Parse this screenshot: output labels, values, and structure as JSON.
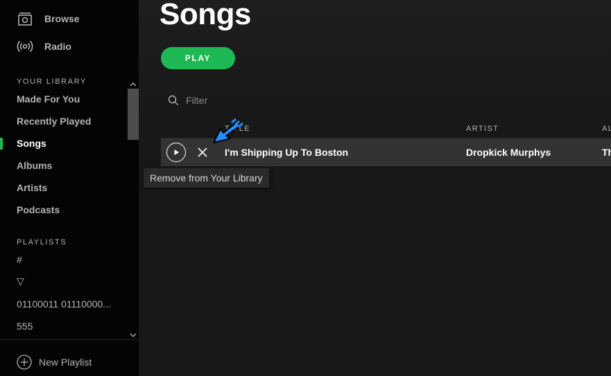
{
  "sidebar": {
    "nav": [
      {
        "label": "Browse",
        "icon": "browse-icon"
      },
      {
        "label": "Radio",
        "icon": "radio-icon"
      }
    ],
    "library_heading": "YOUR LIBRARY",
    "library_items": [
      {
        "label": "Made For You",
        "active": false
      },
      {
        "label": "Recently Played",
        "active": false
      },
      {
        "label": "Songs",
        "active": true
      },
      {
        "label": "Albums",
        "active": false
      },
      {
        "label": "Artists",
        "active": false
      },
      {
        "label": "Podcasts",
        "active": false
      }
    ],
    "playlists_heading": "PLAYLISTS",
    "playlists": [
      {
        "label": "#"
      },
      {
        "label": "▽"
      },
      {
        "label": "01100011 01110000..."
      },
      {
        "label": "555"
      }
    ],
    "new_playlist_label": "New Playlist"
  },
  "main": {
    "title": "Songs",
    "play_label": "PLAY",
    "filter_placeholder": "Filter",
    "columns": {
      "title": "TITLE",
      "artist": "ARTIST",
      "album": "ALBUM"
    },
    "tracks": [
      {
        "title": "I'm Shipping Up To Boston",
        "artist": "Dropkick Murphys",
        "album": "Th"
      }
    ],
    "tooltip": "Remove from Your Library"
  },
  "colors": {
    "accent": "#1db954",
    "sidebar_bg": "#040404",
    "main_bg": "#181818",
    "row_hover": "#333333",
    "cursor": "#1e90ff"
  }
}
